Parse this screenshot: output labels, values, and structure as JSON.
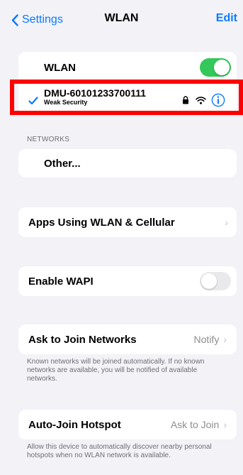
{
  "nav": {
    "back_label": "Settings",
    "title": "WLAN",
    "edit_label": "Edit"
  },
  "wlan": {
    "toggle_label": "WLAN",
    "toggle_on": true,
    "connected_network": {
      "name": "DMU-60101233700111",
      "subtitle": "Weak Security"
    }
  },
  "networks": {
    "header": "NETWORKS",
    "other_label": "Other..."
  },
  "apps_using": {
    "label": "Apps Using WLAN & Cellular"
  },
  "wapi": {
    "label": "Enable WAPI",
    "toggle_on": false
  },
  "ask_join": {
    "label": "Ask to Join Networks",
    "value": "Notify",
    "footer": "Known networks will be joined automatically. If no known networks are available, you will be notified of available networks."
  },
  "auto_join": {
    "label": "Auto-Join Hotspot",
    "value": "Ask to Join",
    "footer": "Allow this device to automatically discover nearby personal hotspots when no WLAN network is available."
  },
  "colors": {
    "accent": "#0a7aff",
    "toggle_on": "#34c759",
    "toggle_off": "#e9e9eb",
    "highlight": "#ff0000"
  }
}
